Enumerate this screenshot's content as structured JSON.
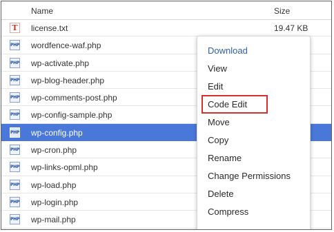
{
  "columns": {
    "name": "Name",
    "size": "Size"
  },
  "files": [
    {
      "name": "license.txt",
      "size": "19.47 KB",
      "icon": "txt"
    },
    {
      "name": "wordfence-waf.php",
      "size": "",
      "icon": "php"
    },
    {
      "name": "wp-activate.php",
      "size": "",
      "icon": "php"
    },
    {
      "name": "wp-blog-header.php",
      "size": "",
      "icon": "php"
    },
    {
      "name": "wp-comments-post.php",
      "size": "",
      "icon": "php"
    },
    {
      "name": "wp-config-sample.php",
      "size": "",
      "icon": "php"
    },
    {
      "name": "wp-config.php",
      "size": "",
      "icon": "php",
      "selected": true
    },
    {
      "name": "wp-cron.php",
      "size": "",
      "icon": "php"
    },
    {
      "name": "wp-links-opml.php",
      "size": "",
      "icon": "php"
    },
    {
      "name": "wp-load.php",
      "size": "",
      "icon": "php"
    },
    {
      "name": "wp-login.php",
      "size": "",
      "icon": "php"
    },
    {
      "name": "wp-mail.php",
      "size": "",
      "icon": "php"
    }
  ],
  "icon_labels": {
    "php": "PHP",
    "txt": "T"
  },
  "context_menu": {
    "items": [
      "Download",
      "View",
      "Edit",
      "Code Edit",
      "Move",
      "Copy",
      "Rename",
      "Change Permissions",
      "Delete",
      "Compress"
    ],
    "highlighted": "Code Edit"
  },
  "colors": {
    "selected_row": "#4a78d8",
    "menu_primary": "#2f5fa8",
    "highlight_border": "#d32f2f"
  }
}
